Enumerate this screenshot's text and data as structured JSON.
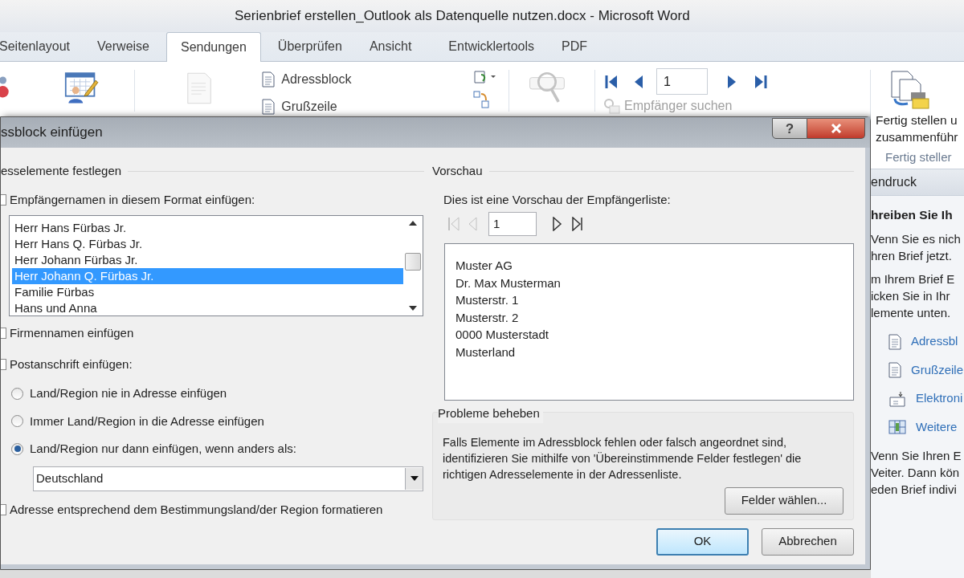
{
  "window": {
    "title": "Serienbrief erstellen_Outlook als Datenquelle nutzen.docx  -  Microsoft Word"
  },
  "tabs": [
    {
      "label": "Seitenlayout",
      "selected": false
    },
    {
      "label": "Verweise",
      "selected": false
    },
    {
      "label": "Sendungen",
      "selected": true
    },
    {
      "label": "Überprüfen",
      "selected": false
    },
    {
      "label": "Ansicht",
      "selected": false
    },
    {
      "label": "Entwicklertools",
      "selected": false
    },
    {
      "label": "PDF",
      "selected": false
    }
  ],
  "ribbon": {
    "fields": [
      {
        "label": "Adressblock"
      },
      {
        "label": "Grußzeile"
      }
    ],
    "record": "1",
    "find_recipient": {
      "label": "Empfänger suchen",
      "disabled": true
    },
    "finish": {
      "lines": [
        "Fertig stellen u",
        "zusammenführ"
      ],
      "group": "Fertig steller"
    }
  },
  "dialog": {
    "title": "ssblock einfügen",
    "help": "?",
    "left": {
      "section": "esselemente festlegen",
      "names_option": {
        "label": "Empfängernamen in diesem Format einfügen:",
        "checked": false
      },
      "name_formats": [
        {
          "text": "Herr Hans Fürbas Jr.",
          "selected": false
        },
        {
          "text": "Herr Hans Q. Fürbas Jr.",
          "selected": false
        },
        {
          "text": "Herr Johann Fürbas Jr.",
          "selected": false
        },
        {
          "text": "Herr Johann Q. Fürbas Jr.",
          "selected": true
        },
        {
          "text": "Familie Fürbas",
          "selected": false
        },
        {
          "text": "Hans und Anna",
          "selected": false
        }
      ],
      "company_option": {
        "label": "Firmennamen einfügen",
        "checked": false
      },
      "postal_option": {
        "label": "Postanschrift einfügen:",
        "checked": false
      },
      "country_options": [
        {
          "label": "Land/Region nie in Adresse einfügen",
          "selected": false
        },
        {
          "label": "Immer Land/Region in die Adresse einfügen",
          "selected": false
        },
        {
          "label": "Land/Region nur dann einfügen, wenn anders als:",
          "selected": true
        }
      ],
      "country": "Deutschland",
      "format_option": {
        "label": "Adresse entsprechend dem Bestimmungsland/der Region formatieren",
        "checked": false
      }
    },
    "preview": {
      "section": "Vorschau",
      "caption": "Dies ist eine Vorschau der Empfängerliste:",
      "record": "1",
      "lines": [
        "Muster AG",
        "Dr. Max Musterman",
        "Musterstr. 1",
        "Musterstr. 2",
        "0000 Musterstadt",
        "Musterland"
      ]
    },
    "problems": {
      "section": "Probleme beheben",
      "text": "Falls Elemente im Adressblock fehlen oder falsch angeordnet sind, identifizieren Sie mithilfe von 'Übereinstimmende Felder festlegen' die richtigen Adresselemente in der Adressenliste.",
      "button": "Felder wählen..."
    },
    "buttons": [
      {
        "label": "OK",
        "default": true
      },
      {
        "label": "Abbrechen",
        "default": false
      }
    ]
  },
  "task_pane": {
    "header": "endruck",
    "heading": "hreiben Sie Ih",
    "para1": [
      "Venn Sie es nich",
      "hren Brief jetzt."
    ],
    "para2": [
      "m Ihrem Brief E",
      "icken Sie in Ihr",
      "lemente unten."
    ],
    "links": [
      {
        "label": "Adressbl",
        "kind": "doc"
      },
      {
        "label": "Grußzeile",
        "kind": "doc"
      },
      {
        "label": "Elektroni",
        "kind": "postage"
      },
      {
        "label": "Weitere",
        "kind": "more"
      }
    ],
    "para3": [
      "Venn Sie Ihren E",
      "Veiter. Dann kön",
      "eden Brief indivi"
    ]
  }
}
